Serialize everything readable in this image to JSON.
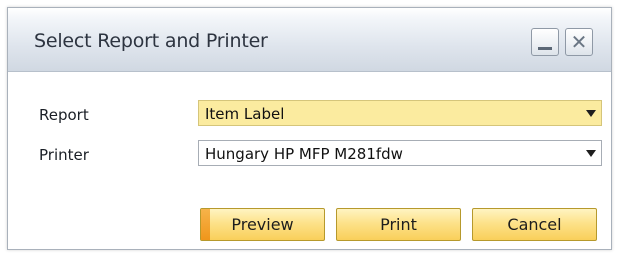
{
  "window": {
    "title": "Select Report and Printer",
    "minimize_icon": "minimize-icon",
    "close_icon": "close-icon",
    "close_glyph": "✕"
  },
  "form": {
    "report": {
      "label": "Report",
      "value": "Item Label"
    },
    "printer": {
      "label": "Printer",
      "value": "Hungary HP MFP M281fdw"
    }
  },
  "buttons": {
    "preview": "Preview",
    "print": "Print",
    "cancel": "Cancel"
  },
  "colors": {
    "active_field": "#fbeb9f",
    "button_fill": "#fde28a",
    "button_accent": "#f0961b"
  }
}
